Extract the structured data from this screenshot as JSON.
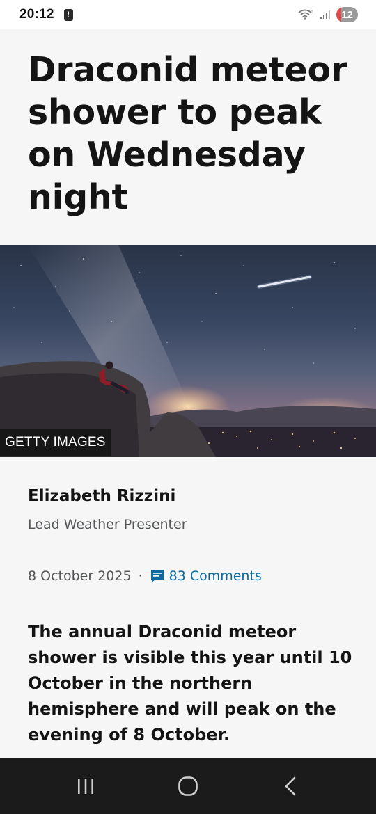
{
  "status_bar": {
    "time": "20:12",
    "battery_level": "12",
    "colors": {
      "battery": "#9a9a9a",
      "battery_low": "#e14b4b"
    }
  },
  "article": {
    "title": "Draconid meteor shower to peak on Wednesday night",
    "image_credit": "GETTY IMAGES",
    "author_name": "Elizabeth Rizzini",
    "author_role": "Lead Weather Presenter",
    "date": "8 October 2025",
    "separator": "·",
    "comments_label": "83 Comments",
    "summary": "The annual Draconid meteor shower is visible this year until 10 October in the northern hemisphere and will peak on the evening of 8 October."
  },
  "nav_bar": {
    "recents_icon": "recents-icon",
    "home_icon": "home-icon",
    "back_icon": "back-icon"
  },
  "colors": {
    "link": "#0b6ba0",
    "text": "#141414",
    "muted": "#545658",
    "background": "#f6f6f6"
  }
}
